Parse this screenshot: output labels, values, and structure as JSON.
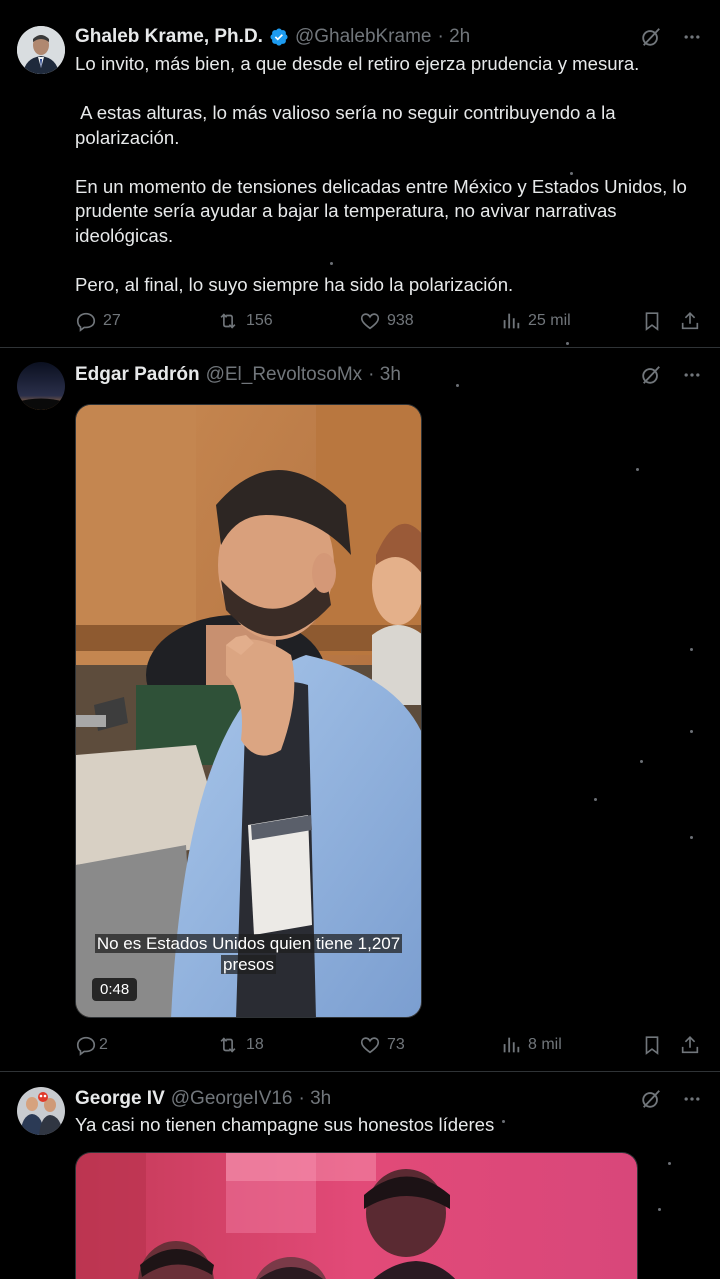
{
  "tweets": [
    {
      "name": "Ghaleb Krame, Ph.D.",
      "handle": "@GhalebKrame",
      "time": "· 2h",
      "verified": true,
      "paragraphs": [
        "Lo invito, más bien, a que desde el retiro ejerza prudencia y mesura.",
        " A estas alturas, lo más valioso sería no seguir contribuyendo a la polarización.",
        "En un momento de tensiones delicadas entre México y Estados Unidos, lo prudente sería ayudar a bajar la temperatura, no avivar narrativas ideológicas.",
        "Pero, al final, lo suyo siempre ha sido la polarización."
      ],
      "stats": {
        "replies": "27",
        "reposts": "156",
        "likes": "938",
        "views": "25 mil"
      }
    },
    {
      "name": "Edgar Padrón",
      "handle": "@El_RevoltosoMx",
      "time": "· 3h",
      "video": {
        "caption_line1": "No es Estados Unidos quien tiene 1,207",
        "caption_line2": "presos",
        "duration": "0:48"
      },
      "stats": {
        "replies": "2",
        "reposts": "18",
        "likes": "73",
        "views": "8 mil"
      }
    },
    {
      "name": "George IV",
      "handle": "@GeorgeIV16",
      "time": "· 3h",
      "text": "Ya casi no tienen champagne sus honestos líderes"
    }
  ],
  "colors": {
    "background": "#000000",
    "text": "#e7e9ea",
    "muted": "#71767b",
    "verified": "#1d9bf0",
    "divider": "#2f3336"
  },
  "icons": [
    "verified-badge-icon",
    "grok-icon",
    "more-icon",
    "reply-icon",
    "repost-icon",
    "like-icon",
    "views-icon",
    "bookmark-icon",
    "share-icon"
  ]
}
